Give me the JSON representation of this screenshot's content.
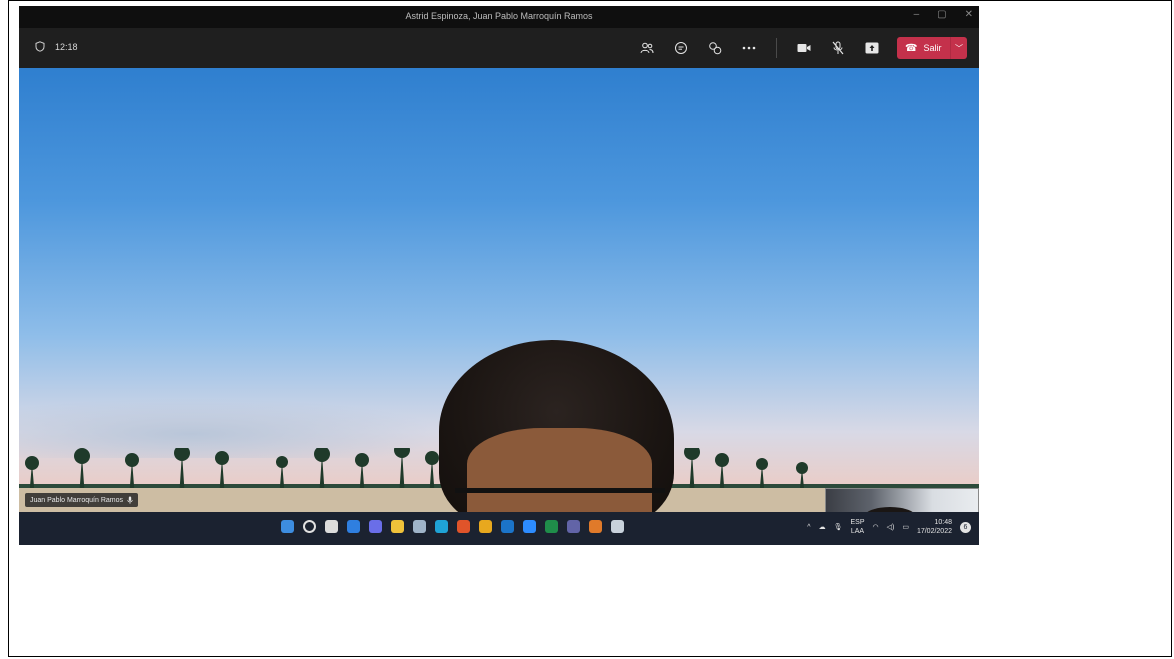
{
  "window": {
    "title": "Astrid Espinoza, Juan Pablo Marroquín Ramos",
    "controls": [
      "–",
      "▢",
      "✕"
    ]
  },
  "meeting": {
    "timer": "12:18",
    "leave_label": "Salir",
    "toolbar_icons": [
      "people-icon",
      "chat-icon",
      "reactions-icon",
      "more-icon",
      "camera-icon",
      "mic-muted-icon",
      "share-icon"
    ],
    "participant_name": "Juan Pablo Marroquín Ramos"
  },
  "taskbar": {
    "apps": [
      "start-icon",
      "search-icon",
      "task-view-icon",
      "widgets-icon",
      "chat-icon",
      "file-explorer-icon",
      "settings-icon",
      "edge-icon",
      "office-icon",
      "chrome-icon",
      "outlook-icon",
      "zoom-icon",
      "excel-icon",
      "teams-icon",
      "paint-icon",
      "app-icon"
    ],
    "app_colors": [
      "#3d8de0",
      "#e0e0e0",
      "#dcdcdc",
      "#2f7fe0",
      "#6a6ee8",
      "#f0c23a",
      "#9fb4c9",
      "#1fa3d6",
      "#e0542a",
      "#e8a81e",
      "#1b74c9",
      "#2d8cff",
      "#1f8d4a",
      "#6264a7",
      "#e07a2a",
      "#c9d2dc"
    ],
    "language_top": "ESP",
    "language_bottom": "LAA",
    "time": "10:48",
    "date": "17/02/2022",
    "notification_count": "6"
  },
  "colors": {
    "leave_button": "#c4314b",
    "title_bar": "#0f0f0f",
    "toolbar": "#1f1f1f",
    "taskbar": "#1b2230"
  }
}
